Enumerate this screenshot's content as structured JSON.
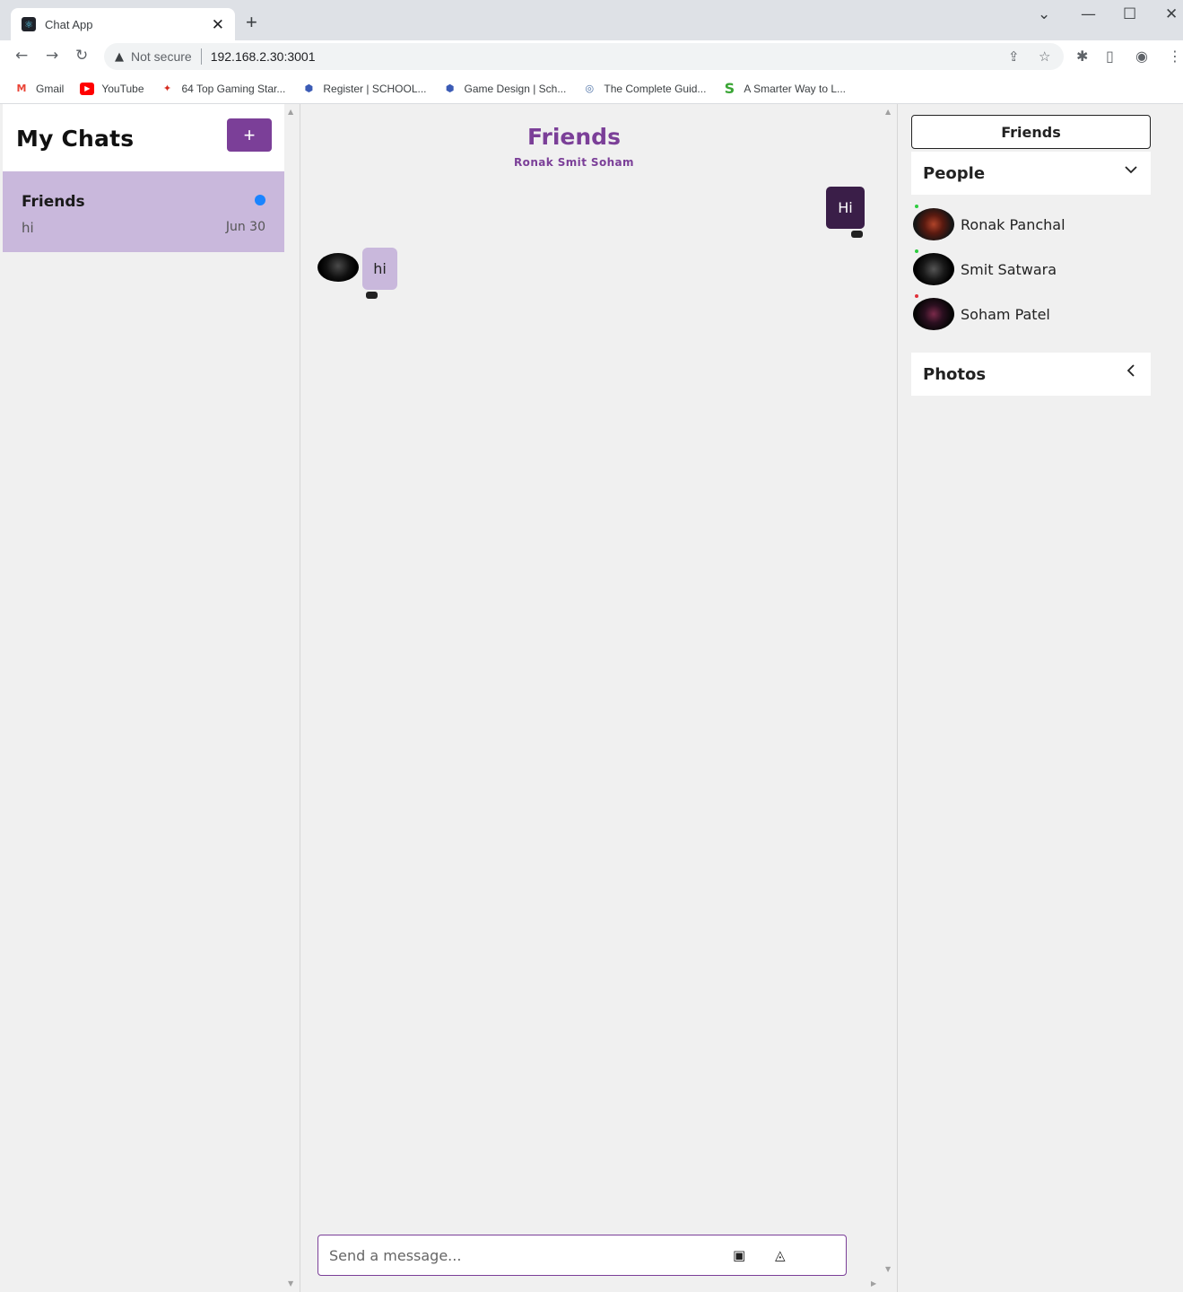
{
  "browser": {
    "tab_title": "Chat App",
    "security_label": "Not secure",
    "url": "192.168.2.30:3001",
    "bookmarks": [
      {
        "label": "Gmail"
      },
      {
        "label": "YouTube"
      },
      {
        "label": "64 Top Gaming Star..."
      },
      {
        "label": "Register | SCHOOL..."
      },
      {
        "label": "Game Design | Sch..."
      },
      {
        "label": "The Complete Guid..."
      },
      {
        "label": "A Smarter Way to L..."
      }
    ]
  },
  "sidebar": {
    "title": "My Chats",
    "add_label": "+",
    "chats": [
      {
        "name": "Friends",
        "last_message": "hi",
        "date": "Jun 30",
        "unread": true
      }
    ]
  },
  "conversation": {
    "title": "Friends",
    "members": "Ronak Smit Soham",
    "messages": [
      {
        "text": "Hi",
        "direction": "outgoing"
      },
      {
        "text": "hi",
        "direction": "incoming"
      }
    ],
    "composer_placeholder": "Send a message..."
  },
  "details": {
    "friends_label": "Friends",
    "people_label": "People",
    "people": [
      {
        "name": "Ronak Panchal",
        "online": true
      },
      {
        "name": "Smit Satwara",
        "online": true
      },
      {
        "name": "Soham Patel",
        "online": false
      }
    ],
    "photos_label": "Photos"
  },
  "colors": {
    "accent": "#7b3f98",
    "outgoing_bubble": "#3a1e48",
    "incoming_bubble": "#c9b8dc",
    "unread_dot": "#1a84ff",
    "online": "#2ecc40",
    "offline": "#e0303a"
  }
}
